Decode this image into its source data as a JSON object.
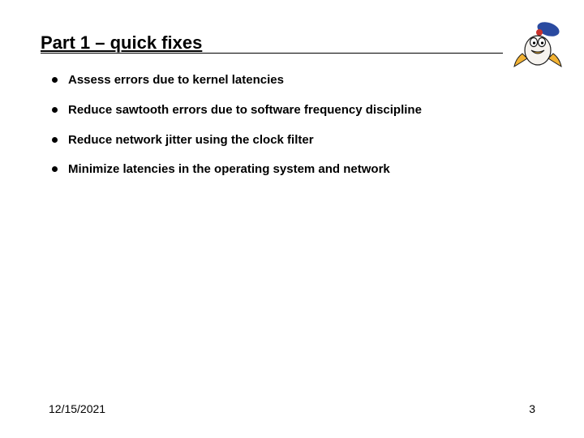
{
  "title": "Part 1 – quick fixes",
  "bullets": [
    "Assess errors due to kernel latencies",
    "Reduce sawtooth errors due to software frequency discipline",
    "Reduce network jitter using the clock filter",
    "Minimize latencies in the operating system and network"
  ],
  "footer": {
    "date": "12/15/2021",
    "page": "3"
  }
}
